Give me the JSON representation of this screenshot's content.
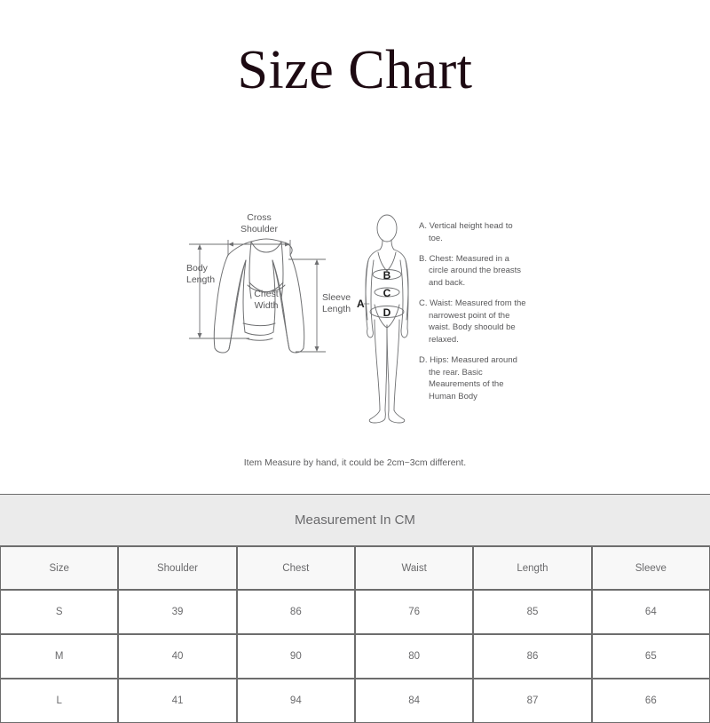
{
  "title": "Size Chart",
  "garment_diagram": {
    "labels": {
      "cross_shoulder": "Cross\nShoulder",
      "cross_shoulder_line1": "Cross",
      "cross_shoulder_line2": "Shoulder",
      "body_length_line1": "Body",
      "body_length_line2": "Length",
      "chest_width_line1": "Chest",
      "chest_width_line2": "Width",
      "sleeve_length_line1": "Sleeve",
      "sleeve_length_line2": "Length"
    }
  },
  "body_diagram": {
    "markers": [
      "A",
      "B",
      "C",
      "D"
    ]
  },
  "legend": {
    "items": [
      "A. Vertical height head to toe.",
      "B. Chest: Measured in a circle around the breasts and back.",
      "C. Waist: Measured from the narrowest point of the waist. Body shoould be relaxed.",
      "D. Hips: Measured around the rear. Basic Meaurements of the Human Body"
    ]
  },
  "note": "Item Measure by hand, it could be 2cm~3cm different.",
  "table": {
    "banner": "Measurement In CM",
    "headers": [
      "Size",
      "Shoulder",
      "Chest",
      "Waist",
      "Length",
      "Sleeve"
    ],
    "rows": [
      {
        "size": "S",
        "shoulder": "39",
        "chest": "86",
        "waist": "76",
        "length": "85",
        "sleeve": "64"
      },
      {
        "size": "M",
        "shoulder": "40",
        "chest": "90",
        "waist": "80",
        "length": "86",
        "sleeve": "65"
      },
      {
        "size": "L",
        "shoulder": "41",
        "chest": "94",
        "waist": "84",
        "length": "87",
        "sleeve": "66"
      }
    ]
  },
  "colors": {
    "title": "#1d0a12",
    "line": "#6f7072",
    "text": "#58585a",
    "table_border": "#6d6d6d",
    "banner_bg": "#ebebeb",
    "header_bg": "#f8f8f8"
  }
}
